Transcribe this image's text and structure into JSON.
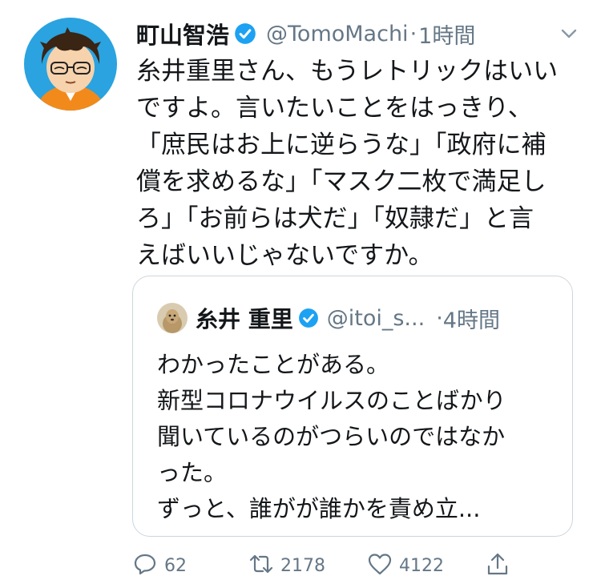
{
  "tweet": {
    "author_name": "町山智浩",
    "author_handle": "@TomoMachi",
    "separator": "·",
    "time": "1時間",
    "text": "糸井重里さん、もうレトリックはいい\nですよ。言いたいことをはっきり、\n「庶民はお上に逆らうな」「政府に補\n償を求めるな」「マスク二枚で満足し\nろ」「お前らは犬だ」「奴隷だ」と言\nえばいいじゃないですか。"
  },
  "quote": {
    "author_name": "糸井 重里",
    "author_handle": "@itoi_s...",
    "separator": "·",
    "time": "4時間",
    "text": "わかったことがある。\n新型コロナウイルスのことばかり\n聞いているのがつらいのではなか\nった。\nずっと、誰がが誰かを責め立..."
  },
  "actions": {
    "reply_count": "62",
    "retweet_count": "2178",
    "like_count": "4122"
  },
  "icons": {
    "verified": "verified-badge-icon",
    "menu": "chevron-down-icon",
    "reply": "reply-icon",
    "retweet": "retweet-icon",
    "like": "heart-icon",
    "share": "share-icon"
  },
  "colors": {
    "verified_blue": "#1da1f2",
    "secondary_text": "#657786",
    "primary_text": "#14171a",
    "border": "#ccd6dd",
    "avatar_bg": "#2aa3e0",
    "avatar_shirt": "#f28a1b"
  }
}
